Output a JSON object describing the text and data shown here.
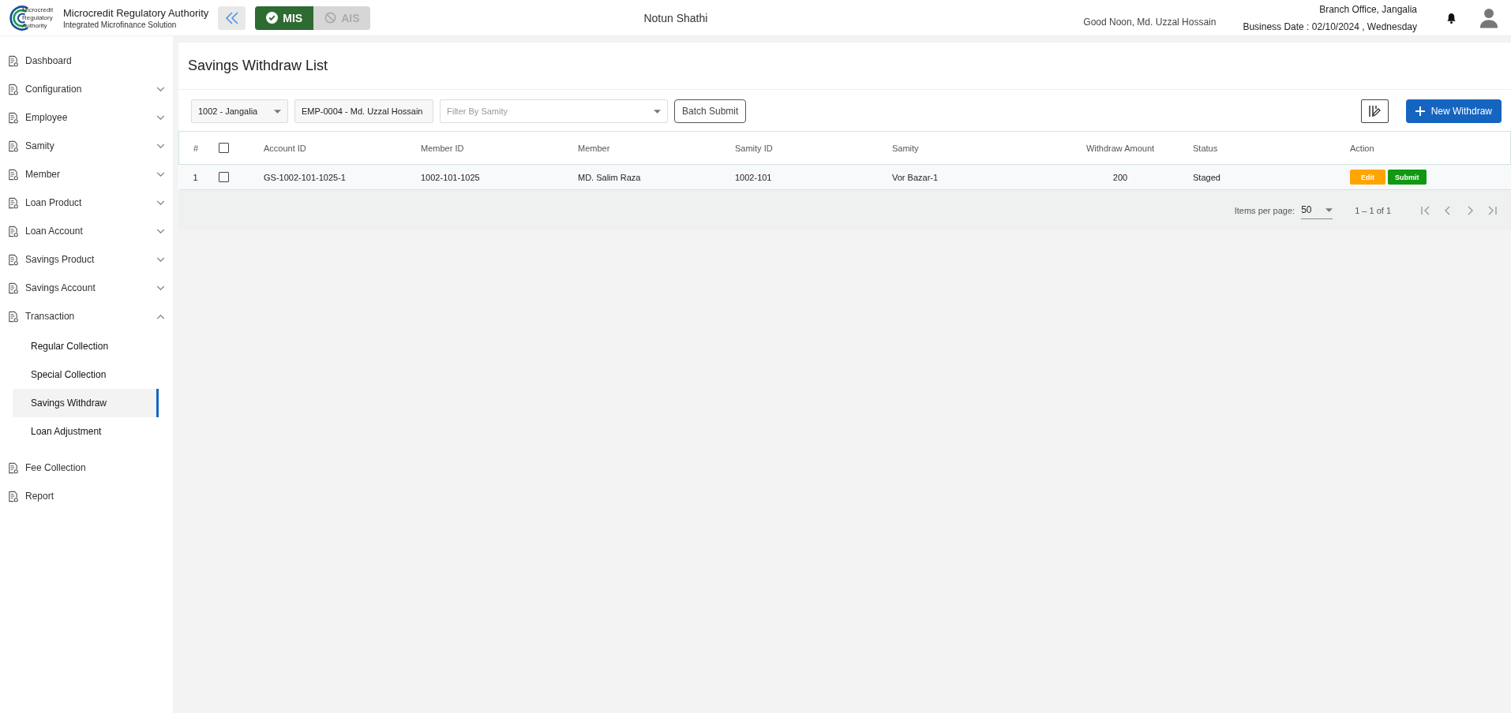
{
  "header": {
    "logo_lines": [
      "Microcredit",
      "Regulatory",
      "Authority"
    ],
    "org_name": "Microcredit Regulatory Authority",
    "org_subtitle": "Integrated Microfinance Solution",
    "modules": [
      {
        "label": "MIS",
        "selected": true
      },
      {
        "label": "AIS",
        "selected": false
      }
    ],
    "app_name": "Notun Shathi",
    "greeting": "Good Noon, Md. Uzzal Hossain",
    "branch": "Branch Office, Jangalia",
    "business_date": "Business Date : 02/10/2024 , Wednesday"
  },
  "sidebar": {
    "items": [
      {
        "label": "Dashboard",
        "expandable": false
      },
      {
        "label": "Configuration",
        "expandable": true,
        "expanded": false
      },
      {
        "label": "Employee",
        "expandable": true,
        "expanded": false
      },
      {
        "label": "Samity",
        "expandable": true,
        "expanded": false
      },
      {
        "label": "Member",
        "expandable": true,
        "expanded": false
      },
      {
        "label": "Loan Product",
        "expandable": true,
        "expanded": false
      },
      {
        "label": "Loan Account",
        "expandable": true,
        "expanded": false
      },
      {
        "label": "Savings Product",
        "expandable": true,
        "expanded": false
      },
      {
        "label": "Savings Account",
        "expandable": true,
        "expanded": false
      },
      {
        "label": "Transaction",
        "expandable": true,
        "expanded": true,
        "children": [
          {
            "label": "Regular Collection",
            "selected": false
          },
          {
            "label": "Special Collection",
            "selected": false
          },
          {
            "label": "Savings Withdraw",
            "selected": true
          },
          {
            "label": "Loan Adjustment",
            "selected": false
          }
        ]
      },
      {
        "label": "Fee Collection",
        "expandable": false
      },
      {
        "label": "Report",
        "expandable": false
      }
    ]
  },
  "page_title": "Savings Withdraw List",
  "filters": {
    "branch": "1002 - Jangalia",
    "employee": "EMP-0004 - Md. Uzzal Hossain",
    "samity_placeholder": "Filter By Samity",
    "batch_button": "Batch Submit",
    "new_button": "New Withdraw"
  },
  "table": {
    "columns": [
      "#",
      "Account ID",
      "Member ID",
      "Member",
      "Samity ID",
      "Samity",
      "Withdraw Amount",
      "Status",
      "Action"
    ],
    "header_checked": false,
    "rows": [
      {
        "index": "1",
        "checked": false,
        "account_id": "GS-1002-101-1025-1",
        "member_id": "1002-101-1025",
        "member": "MD. Salim Raza",
        "samity_id": "1002-101",
        "samity": "Vor Bazar-1",
        "amount": "200",
        "status": "Staged",
        "actions": [
          "Edit",
          "Submit"
        ]
      }
    ]
  },
  "pagination": {
    "label": "Items per page:",
    "page_size": "50",
    "range": "1 – 1 of 1"
  }
}
